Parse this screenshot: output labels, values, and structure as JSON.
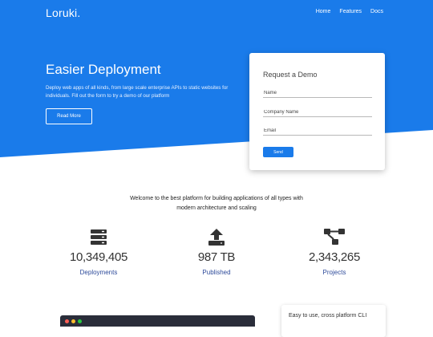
{
  "header": {
    "brand": "Loruki.",
    "nav": [
      "Home",
      "Features",
      "Docs"
    ]
  },
  "hero": {
    "title": "Easier Deployment",
    "text": "Deploy web apps of all kinds, from large scale enterprise APIs to static websites for individuals. Fill out the form to try a demo of our platform",
    "button": "Read More"
  },
  "form": {
    "title": "Request a Demo",
    "name_placeholder": "Name",
    "company_placeholder": "Company Name",
    "email_placeholder": "Email",
    "send": "Send"
  },
  "stats": {
    "intro": "Welcome to the best platform for building applications of all types with modern architecture and scaling",
    "items": [
      {
        "icon": "server-icon",
        "value": "10,349,405",
        "label": "Deployments"
      },
      {
        "icon": "upload-icon",
        "value": "987 TB",
        "label": "Published"
      },
      {
        "icon": "project-diagram-icon",
        "value": "2,343,265",
        "label": "Projects"
      }
    ]
  },
  "cli": {
    "title": "Easy to use, cross platform CLI"
  },
  "colors": {
    "primary": "#1a7bea",
    "hero_bg": "#1a7bea",
    "stat_label": "#2d4a9a"
  }
}
